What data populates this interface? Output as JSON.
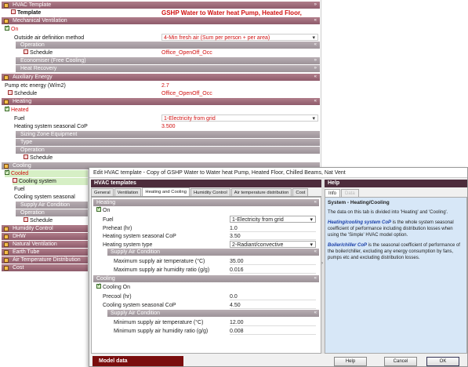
{
  "background_panel": {
    "rows": [
      {
        "kind": "header",
        "text": "HVAC Template"
      },
      {
        "kind": "label-bold",
        "text": "Template",
        "value": "GSHP Water to Water heat Pump, Heated Floor,"
      },
      {
        "kind": "header",
        "text": "Mechanical Ventilation"
      },
      {
        "kind": "check",
        "text": "On"
      },
      {
        "kind": "field",
        "text": "Outside air definition method",
        "value": "4-Min fresh air (Sum per person + per area)",
        "dropdown": true
      },
      {
        "kind": "sub",
        "text": "Operation"
      },
      {
        "kind": "schedule",
        "text": "Schedule",
        "value": "Office_OpenOff_Occ"
      },
      {
        "kind": "sub",
        "text": "Economiser (Free Cooling)"
      },
      {
        "kind": "sub",
        "text": "Heat Recovery"
      },
      {
        "kind": "header",
        "text": "Auxiliary Energy"
      },
      {
        "kind": "field0",
        "text": "Pump etc energy (W/m2)",
        "value": "2.7"
      },
      {
        "kind": "schedule0",
        "text": "Schedule",
        "value": "Office_OpenOff_Occ"
      },
      {
        "kind": "header",
        "text": "Heating"
      },
      {
        "kind": "check",
        "text": "Heated"
      },
      {
        "kind": "field",
        "text": "Fuel",
        "value": "1-Electricity from grid",
        "dropdown": true
      },
      {
        "kind": "field",
        "text": "Heating system seasonal CoP",
        "value": "3.500"
      },
      {
        "kind": "sub",
        "text": "Sizing Zone Equipment"
      },
      {
        "kind": "sub",
        "text": "Type"
      },
      {
        "kind": "sub",
        "text": "Operation"
      },
      {
        "kind": "schedule",
        "text": "Schedule",
        "value": ""
      },
      {
        "kind": "header",
        "text": "Cooling"
      },
      {
        "kind": "check-sel",
        "text": "Cooled"
      },
      {
        "kind": "label-sel",
        "text": "Cooling system",
        "value": ""
      },
      {
        "kind": "field",
        "text": "Fuel",
        "value": ""
      },
      {
        "kind": "field",
        "text": "Cooling system seasonal",
        "value": ""
      },
      {
        "kind": "sub",
        "text": "Supply Air Condition"
      },
      {
        "kind": "sub",
        "text": "Operation"
      },
      {
        "kind": "schedule",
        "text": "Schedule",
        "value": ""
      },
      {
        "kind": "header",
        "text": "Humidity Control"
      },
      {
        "kind": "header",
        "text": "DHW"
      },
      {
        "kind": "header",
        "text": "Natural Ventilation"
      },
      {
        "kind": "header",
        "text": "Earth Tube"
      },
      {
        "kind": "header",
        "text": "Air Temperature Distribution"
      },
      {
        "kind": "header",
        "text": "Cost"
      }
    ]
  },
  "dialog": {
    "title": "Edit HVAC template - Copy of GSHP Water to Water heat Pump, Heated Floor, Chilled Beams, Nat Vent",
    "left_header": "HVAC templates",
    "tabs": [
      "General",
      "Ventilation",
      "Heating and Cooling",
      "Humidity Control",
      "Air temperature distribution",
      "Cost"
    ],
    "active_tab": "Heating and Cooling",
    "form": {
      "heating_header": "Heating",
      "heating_on": "On",
      "fuel_label": "Fuel",
      "fuel_value": "1-Electricity from grid",
      "preheat_label": "Preheat (hr)",
      "preheat_value": "1.0",
      "cop_label": "Heating system seasonal CoP",
      "cop_value": "3.50",
      "type_label": "Heating system type",
      "type_value": "2-Radiant/convective",
      "sac_header": "Supply Air Condition",
      "max_temp_label": "Maximum supply air temperature (°C)",
      "max_temp_value": "35.00",
      "max_hum_label": "Maximum supply air humidity ratio (g/g)",
      "max_hum_value": "0.016",
      "cooling_header": "Cooling",
      "cooling_on": "Cooling On",
      "precool_label": "Precool (hr)",
      "precool_value": "0.0",
      "ccop_label": "Cooling system seasonal CoP",
      "ccop_value": "4.50",
      "csac_header": "Supply Air Condition",
      "min_temp_label": "Minimum supply air temperature (°C)",
      "min_temp_value": "12.00",
      "min_hum_label": "Minimum supply air humidity ratio (g/g)",
      "min_hum_value": "0.008"
    },
    "help": {
      "header": "Help",
      "tab_info": "Info",
      "tab_data": "Data",
      "title": "System - Heating/Cooling",
      "p1": "The data on this tab is divided into 'Heating' and 'Cooling'.",
      "p2_term": "Heating/cooling system CoP",
      "p2_rest": " is the whole system seasonal coefficient of performance including distribution losses when using the 'Simple' HVAC model option.",
      "p3_term": "Boiler/chiller CoP",
      "p3_rest": " is the seasonal coefficient of performance of the boiler/chiller, excluding any energy consumption by fans, pumps etc and excluding distribution losses."
    },
    "model_data": "Model data",
    "buttons": {
      "help": "Help",
      "cancel": "Cancel",
      "ok": "OK"
    }
  }
}
